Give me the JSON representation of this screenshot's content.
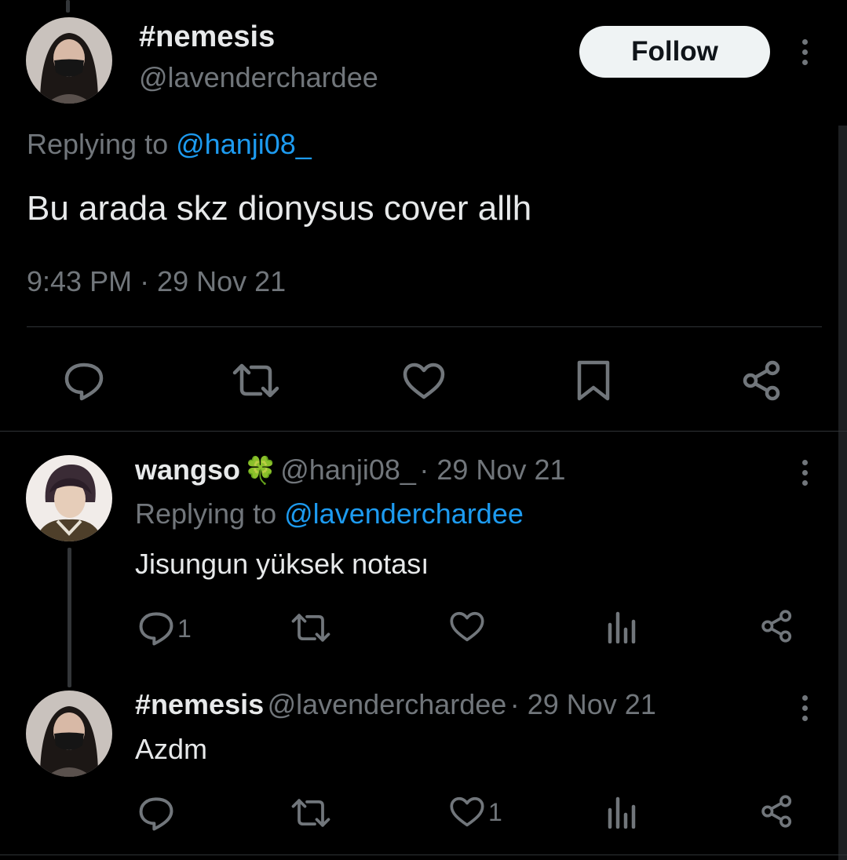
{
  "main_tweet": {
    "display_name": "#nemesis",
    "handle": "@lavenderchardee",
    "follow_label": "Follow",
    "replying_prefix": "Replying to",
    "replying_to": "@hanji08_",
    "text": "Bu arada skz dionysus cover allh",
    "timestamp": "9:43 PM · 29 Nov 21",
    "actions": [
      "reply-icon",
      "retweet-icon",
      "like-icon",
      "bookmark-icon",
      "share-icon"
    ]
  },
  "replies": [
    {
      "display_name": "wangso",
      "emoji": "🍀",
      "handle": "@hanji08_",
      "date": "· 29 Nov 21",
      "replying_prefix": "Replying to",
      "replying_to": "@lavenderchardee",
      "text": "Jisungun yüksek notası",
      "reply_count": "1",
      "like_count": ""
    },
    {
      "display_name": "#nemesis",
      "handle": "@lavenderchardee",
      "date": "· 29 Nov 21",
      "text": "Azdm",
      "reply_count": "",
      "like_count": "1"
    }
  ],
  "colors": {
    "background": "#000000",
    "text": "#e7e9ea",
    "muted": "#71767b",
    "link": "#1d9bf0",
    "divider": "#2f3336"
  }
}
